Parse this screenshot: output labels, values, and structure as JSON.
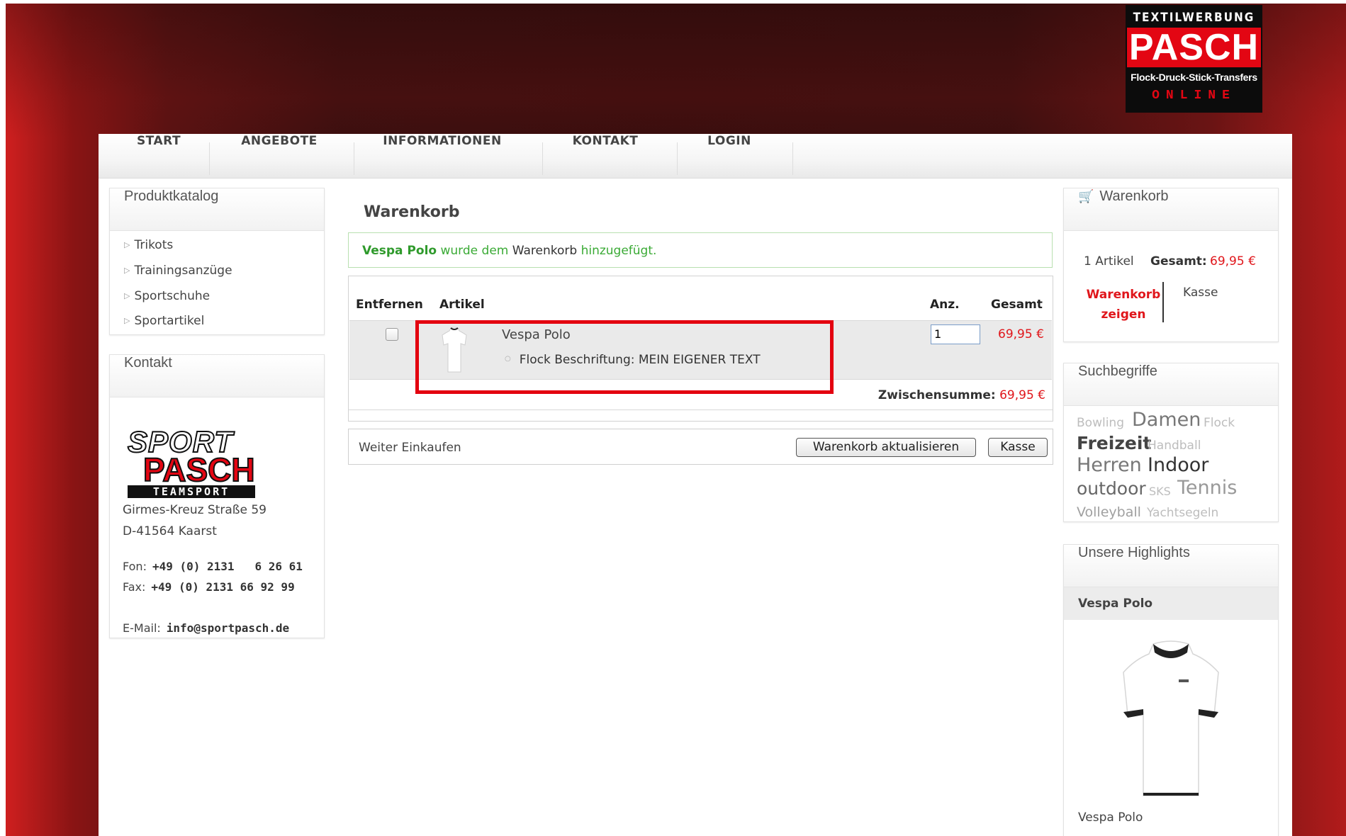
{
  "logo": {
    "line1": "TEXTILWERBUNG",
    "line2": "PASCH",
    "line3": "Flock-Druck-Stick-Transfers",
    "line4": "ONLINE"
  },
  "nav": {
    "items": [
      "START",
      "ANGEBOTE",
      "INFORMATIONEN",
      "KONTAKT",
      "LOGIN"
    ]
  },
  "catalog": {
    "title": "Produktkatalog",
    "items": [
      "Trikots",
      "Trainingsanzüge",
      "Sportschuhe",
      "Sportartikel"
    ]
  },
  "contact": {
    "title": "Kontakt",
    "logo_top": "SPORT",
    "logo_mid": "PASCH",
    "logo_bot": "TEAMSPORT",
    "street": "Girmes-Kreuz Straße 59",
    "city": "D-41564 Kaarst",
    "fon_label": "Fon:",
    "fon_value": "+49 (0) 2131   6 26 61",
    "fax_label": "Fax:",
    "fax_value": "+49 (0) 2131 66 92 99",
    "mail_label": "E-Mail:",
    "mail_value": "info@sportpasch.de"
  },
  "main": {
    "title": "Warenkorb",
    "message": {
      "product": "Vespa Polo",
      "part1": "wurde dem",
      "part2": "Warenkorb",
      "part3": "hinzugefügt."
    },
    "table": {
      "headers": {
        "remove": "Entfernen",
        "article": "Artikel",
        "qty": "Anz.",
        "total": "Gesamt"
      },
      "row": {
        "name": "Vespa Polo",
        "option": "Flock Beschriftung: MEIN EIGENER TEXT",
        "qty": "1",
        "price": "69,95 €"
      },
      "subtotal_label": "Zwischensumme:",
      "subtotal_value": "69,95 €"
    },
    "continue_label": "Weiter Einkaufen",
    "update_label": "Warenkorb aktualisieren",
    "checkout_label": "Kasse"
  },
  "sidecart": {
    "title": "Warenkorb",
    "count": "1 Artikel",
    "total_label": "Gesamt:",
    "total_value": "69,95 €",
    "show_line1": "Warenkorb",
    "show_line2": "zeigen",
    "checkout": "Kasse"
  },
  "tags": {
    "title": "Suchbegriffe",
    "items": [
      "Bowling",
      "Damen",
      "Flock",
      "Freizeit",
      "Handball",
      "Herren",
      "Indoor",
      "outdoor",
      "SKS",
      "Tennis",
      "Volleyball",
      "Yachtsegeln"
    ]
  },
  "highlights": {
    "title": "Unsere Highlights",
    "product": "Vespa Polo",
    "caption": "Vespa Polo"
  },
  "colors": {
    "accent": "#e0161b",
    "success": "#3aaa35",
    "background": "#3a0e0e"
  }
}
